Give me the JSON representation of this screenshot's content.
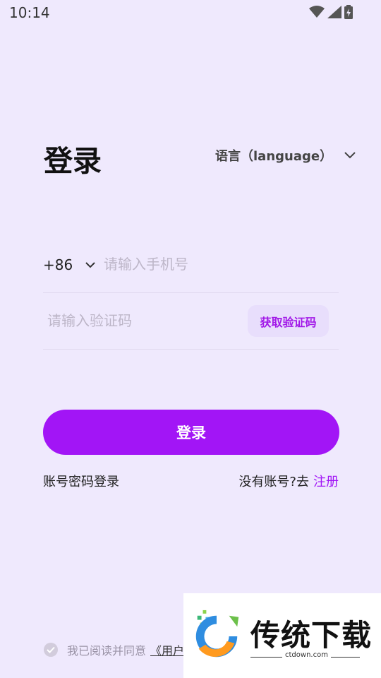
{
  "status_bar": {
    "time": "10:14",
    "icons": [
      "wifi-icon",
      "cell-signal-icon",
      "battery-charging-icon"
    ]
  },
  "header": {
    "title": "登录",
    "language_label": "语言（language）"
  },
  "phone": {
    "country_code": "+86",
    "placeholder": "请输入手机号",
    "value": ""
  },
  "code": {
    "placeholder": "请输入验证码",
    "value": "",
    "get_code_label": "获取验证码"
  },
  "login_button_label": "登录",
  "password_login_label": "账号密码登录",
  "register": {
    "prompt": "没有账号?去",
    "link_label": "注册"
  },
  "agreement": {
    "text": "我已阅读并同意",
    "link_visible": "《用户"
  },
  "watermark": {
    "title": "传统下载",
    "domain": "ctdown.com"
  },
  "colors": {
    "background": "#efe9fd",
    "accent": "#a215f6",
    "code_button_bg": "#e8defc"
  }
}
